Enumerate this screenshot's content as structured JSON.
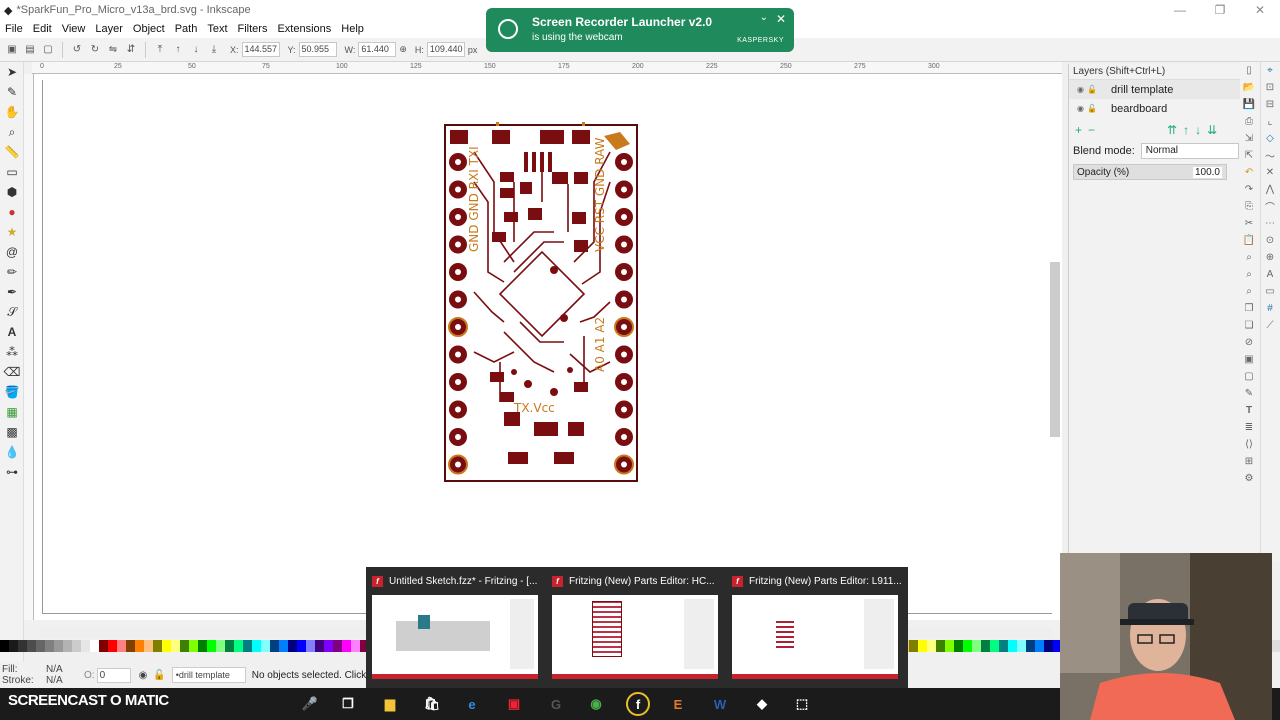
{
  "window": {
    "title": "*SparkFun_Pro_Micro_v13a_brd.svg - Inkscape",
    "controls": [
      "—",
      "❐",
      "✕"
    ]
  },
  "menu": [
    "File",
    "Edit",
    "View",
    "Layer",
    "Object",
    "Path",
    "Text",
    "Filters",
    "Extensions",
    "Help"
  ],
  "toolctrl": {
    "x_label": "X:",
    "x_value": "144.557",
    "y_label": "Y:",
    "y_value": "50.955",
    "w_label": "W:",
    "w_value": "61.440",
    "h_label": "H:",
    "h_value": "109.440",
    "units": "px"
  },
  "ruler": {
    "ticks": [
      "0",
      "25",
      "50",
      "75",
      "100",
      "125",
      "150",
      "175",
      "200",
      "225",
      "250",
      "275",
      "300"
    ]
  },
  "layers_panel": {
    "title": "Layers (Shift+Ctrl+L)",
    "layers": [
      {
        "name": "drill template"
      },
      {
        "name": "beardboard"
      }
    ],
    "blend_label": "Blend mode:",
    "blend_value": "Normal",
    "opacity_label": "Opacity (%)",
    "opacity_value": "100.0"
  },
  "statusbar": {
    "fill_label": "Fill:",
    "fill_value": "N/A",
    "stroke_label": "Stroke:",
    "stroke_value": "N/A",
    "opacity_value": "0",
    "layer_value": "•drill template",
    "message": "No objects selected. Click, Shift"
  },
  "notification": {
    "title": "Screen Recorder Launcher v2.0",
    "subtitle": "is using the webcam",
    "brand": "KASPERSKY"
  },
  "taskbar_previews": [
    {
      "title": "Untitled Sketch.fzz* - Fritzing - [..."
    },
    {
      "title": "Fritzing (New) Parts Editor: HC..."
    },
    {
      "title": "Fritzing (New) Parts Editor: L911..."
    }
  ],
  "watermark": "SCREENCAST O MATIC",
  "colors": {
    "pcb": "#7a0d10",
    "silk": "#c97a1c",
    "notify": "#1f8a5c"
  },
  "icons": [
    "pointer-icon",
    "node-icon",
    "zoom-icon",
    "rect-icon",
    "circle-icon",
    "star-icon",
    "spiral-icon",
    "pencil-icon",
    "pen-icon",
    "text-icon",
    "spray-icon",
    "eraser-icon",
    "bucket-icon",
    "gradient-icon",
    "dropper-icon"
  ]
}
